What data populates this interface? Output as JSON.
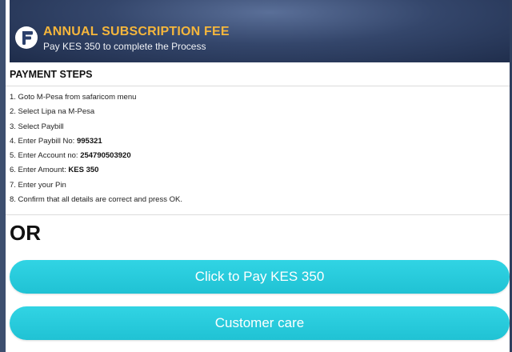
{
  "header": {
    "title": "ANNUAL SUBSCRIPTION FEE",
    "subtitle": "Pay KES 350 to complete the Process",
    "logo_icon": "app-logo-f"
  },
  "payment": {
    "section_title": "PAYMENT STEPS",
    "steps": [
      {
        "text": "1. Goto M-Pesa from safaricom menu",
        "value": ""
      },
      {
        "text": "2. Select Lipa na M-Pesa",
        "value": ""
      },
      {
        "text": "3. Select Paybill",
        "value": ""
      },
      {
        "text": "4. Enter Paybill No: ",
        "value": "995321"
      },
      {
        "text": "5. Enter Account no: ",
        "value": "254790503920"
      },
      {
        "text": "6. Enter Amount: ",
        "value": "KES 350"
      },
      {
        "text": "7. Enter your Pin",
        "value": ""
      },
      {
        "text": "8. Confirm that all details are correct and press OK.",
        "value": ""
      }
    ]
  },
  "or_label": "OR",
  "actions": {
    "pay_label": "Click to Pay KES 350",
    "care_label": "Customer care"
  },
  "colors": {
    "accent_title": "#f5b63c",
    "button": "#25c8da",
    "header_bg": "#34466b"
  }
}
